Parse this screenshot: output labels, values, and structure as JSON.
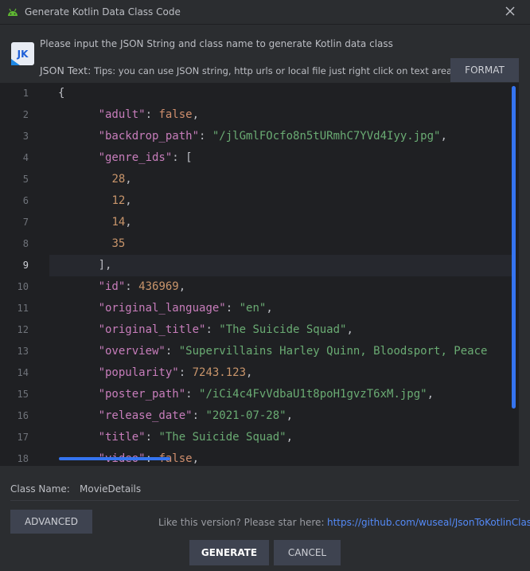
{
  "window": {
    "title": "Generate Kotlin Data Class Code",
    "close_icon": "close-icon",
    "app_icon": "android-icon"
  },
  "header": {
    "logo_text": "JK",
    "hint": "Please input the JSON String and class name to generate Kotlin data class",
    "json_label": "JSON Text:",
    "tips": "Tips: you can use JSON string, http urls or local file just right click on text area",
    "format_label": "FORMAT"
  },
  "editor": {
    "line_numbers": [
      "1",
      "2",
      "3",
      "4",
      "5",
      "6",
      "7",
      "8",
      "9",
      "10",
      "11",
      "12",
      "13",
      "14",
      "15",
      "16",
      "17",
      "18"
    ],
    "current_line": "9",
    "lines": [
      {
        "indent": "",
        "key": "",
        "sep": "",
        "value": "",
        "punct": "{"
      },
      {
        "indent": "      ",
        "key": "\"adult\"",
        "sep": ": ",
        "value": "false",
        "punct": ","
      },
      {
        "indent": "      ",
        "key": "\"backdrop_path\"",
        "sep": ": ",
        "value": "\"/jlGmlFOcfo8n5tURmhC7YVd4Iyy.jpg\"",
        "punct": ","
      },
      {
        "indent": "      ",
        "key": "\"genre_ids\"",
        "sep": ": ",
        "value": "",
        "punct": "["
      },
      {
        "indent": "        ",
        "key": "",
        "sep": "",
        "value": "28",
        "punct": ","
      },
      {
        "indent": "        ",
        "key": "",
        "sep": "",
        "value": "12",
        "punct": ","
      },
      {
        "indent": "        ",
        "key": "",
        "sep": "",
        "value": "14",
        "punct": ","
      },
      {
        "indent": "        ",
        "key": "",
        "sep": "",
        "value": "35",
        "punct": ""
      },
      {
        "indent": "      ",
        "key": "",
        "sep": "",
        "value": "",
        "punct": "],"
      },
      {
        "indent": "      ",
        "key": "\"id\"",
        "sep": ": ",
        "value": "436969",
        "punct": ","
      },
      {
        "indent": "      ",
        "key": "\"original_language\"",
        "sep": ": ",
        "value": "\"en\"",
        "punct": ","
      },
      {
        "indent": "      ",
        "key": "\"original_title\"",
        "sep": ": ",
        "value": "\"The Suicide Squad\"",
        "punct": ","
      },
      {
        "indent": "      ",
        "key": "\"overview\"",
        "sep": ": ",
        "value": "\"Supervillains Harley Quinn, Bloodsport, Peace",
        "punct": ""
      },
      {
        "indent": "      ",
        "key": "\"popularity\"",
        "sep": ": ",
        "value": "7243.123",
        "punct": ","
      },
      {
        "indent": "      ",
        "key": "\"poster_path\"",
        "sep": ": ",
        "value": "\"/iCi4c4FvVdbaU1t8poH1gvzT6xM.jpg\"",
        "punct": ","
      },
      {
        "indent": "      ",
        "key": "\"release_date\"",
        "sep": ": ",
        "value": "\"2021-07-28\"",
        "punct": ","
      },
      {
        "indent": "      ",
        "key": "\"title\"",
        "sep": ": ",
        "value": "\"The Suicide Squad\"",
        "punct": ","
      },
      {
        "indent": "      ",
        "key": "\"video\"",
        "sep": ": ",
        "value": "false",
        "punct": ","
      }
    ]
  },
  "class_name": {
    "label": "Class Name:",
    "value": "MovieDetails"
  },
  "footer": {
    "advanced_label": "ADVANCED",
    "star_text": "Like this version? Please star here:",
    "star_link": "https://github.com/wuseal/JsonToKotlinClass",
    "generate_label": "GENERATE",
    "cancel_label": "CANCEL"
  },
  "colors": {
    "background": "#2b2d30",
    "editor_bg": "#1f2023",
    "key": "#c77dbb",
    "string": "#6aab73",
    "number": "#2aacb8",
    "keyword": "#cf8e6d",
    "accent": "#3574f0",
    "link": "#548af7"
  }
}
